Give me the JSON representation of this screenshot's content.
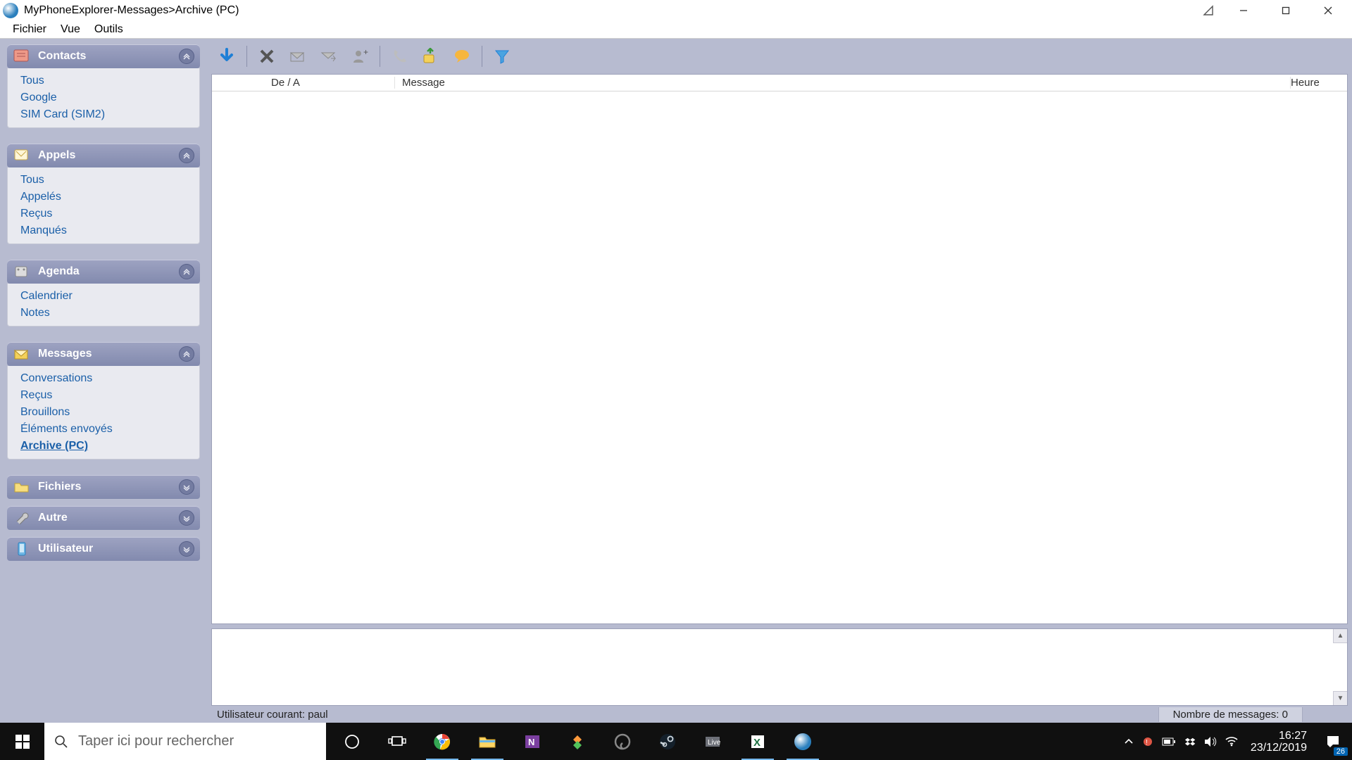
{
  "title": {
    "app": "MyPhoneExplorer",
    "sep": " -  ",
    "section": "Messages",
    "arrow": " > ",
    "sub": "Archive (PC)"
  },
  "menus": {
    "file": "Fichier",
    "view": "Vue",
    "tools": "Outils"
  },
  "sidebar": {
    "contacts": {
      "title": "Contacts",
      "items": [
        "Tous",
        "Google",
        "SIM Card (SIM2)"
      ]
    },
    "calls": {
      "title": "Appels",
      "items": [
        "Tous",
        "Appelés",
        "Reçus",
        "Manqués"
      ]
    },
    "agenda": {
      "title": "Agenda",
      "items": [
        "Calendrier",
        "Notes"
      ]
    },
    "messages": {
      "title": "Messages",
      "items": [
        "Conversations",
        "Reçus",
        "Brouillons",
        "Éléments envoyés",
        "Archive (PC)"
      ],
      "active_index": 4
    },
    "files": {
      "title": "Fichiers"
    },
    "other": {
      "title": "Autre"
    },
    "user": {
      "title": "Utilisateur"
    }
  },
  "columns": {
    "from": "De / A",
    "msg": "Message",
    "time": "Heure"
  },
  "status": {
    "left_label": "Utilisateur courant: ",
    "left_value": "paul",
    "right_label": "Nombre de messages: ",
    "right_value": "0"
  },
  "taskbar": {
    "search_placeholder": "Taper ici pour rechercher",
    "time": "16:27",
    "date": "23/12/2019",
    "notif_count": "26"
  }
}
